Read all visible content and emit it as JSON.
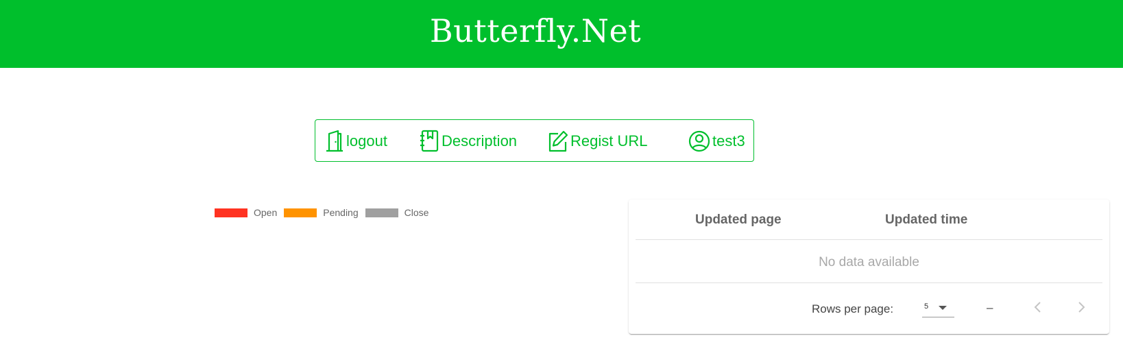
{
  "header": {
    "title": "Butterfly.Net",
    "background_color": "#00bf2c"
  },
  "nav": {
    "accent_color": "#00bf2c",
    "items": [
      {
        "label": "logout",
        "icon": "door-icon"
      },
      {
        "label": "Description",
        "icon": "book-icon"
      },
      {
        "label": "Regist URL",
        "icon": "edit-icon"
      },
      {
        "label": "test3",
        "icon": "user-circle-icon"
      }
    ]
  },
  "legend": {
    "items": [
      {
        "label": "Open",
        "color": "#ff3322"
      },
      {
        "label": "Pending",
        "color": "#ff9300"
      },
      {
        "label": "Close",
        "color": "#a0a0a0"
      }
    ]
  },
  "table": {
    "columns": [
      "Updated page",
      "Updated time"
    ],
    "rows": [],
    "empty_text": "No data available",
    "footer": {
      "rows_per_page_label": "Rows per page:",
      "rows_per_page_value": "5",
      "range_text": "–",
      "prev_icon": "chevron-left-icon",
      "next_icon": "chevron-right-icon"
    }
  }
}
